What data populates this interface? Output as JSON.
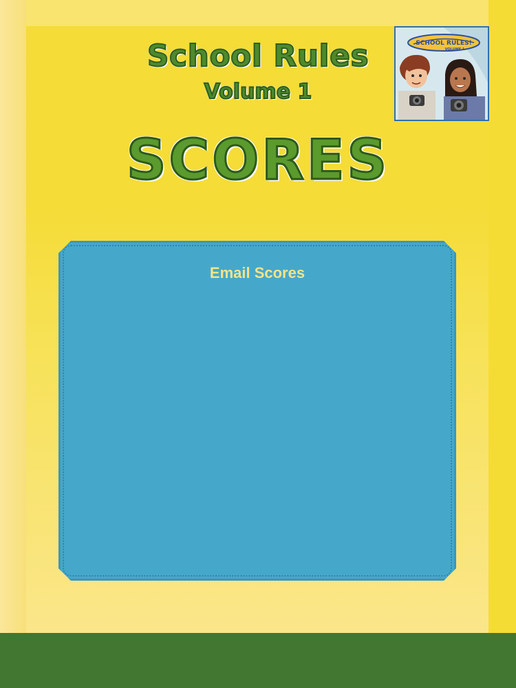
{
  "header": {
    "title": "School Rules",
    "subtitle": "Volume 1",
    "section_title": "SCORES"
  },
  "cover_image": {
    "icon": "school-rules-cover-art",
    "text": "SCHOOL RULES! VOLUME 1"
  },
  "score_panel": {
    "email_button_label": "Email Scores"
  },
  "colors": {
    "background": "#f5dc37",
    "title_green": "#4e8a2c",
    "panel_blue": "#45a8ca",
    "email_text": "#f3e38a",
    "footer_green": "#417730"
  }
}
